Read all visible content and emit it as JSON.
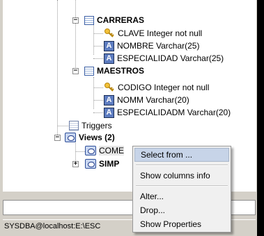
{
  "tree": {
    "carreras": {
      "name": "CARRERAS",
      "fields": [
        {
          "type": "key",
          "label": "CLAVE Integer not null"
        },
        {
          "type": "field",
          "label": "NOMBRE Varchar(25)"
        },
        {
          "type": "field",
          "label": "ESPECIALIDAD Varchar(25)"
        }
      ]
    },
    "maestros": {
      "name": "MAESTROS",
      "fields": [
        {
          "type": "key",
          "label": "CODIGO Integer not null"
        },
        {
          "type": "field",
          "label": "NOMM Varchar(20)"
        },
        {
          "type": "field",
          "label": "ESPECIALIDADM Varchar(20)"
        }
      ]
    },
    "triggers_label": "Triggers",
    "views_label": "Views (2)",
    "view_items": [
      "COME",
      "SIMP"
    ],
    "field_icon_letter": "A",
    "expand_minus": "−",
    "expand_plus": "+"
  },
  "context_menu": {
    "items": [
      "Select from ...",
      "Show columns info",
      "Alter...",
      "Drop...",
      "Show Properties"
    ]
  },
  "status_bar": {
    "text": "SYSDBA@localhost:E:\\ESC"
  }
}
